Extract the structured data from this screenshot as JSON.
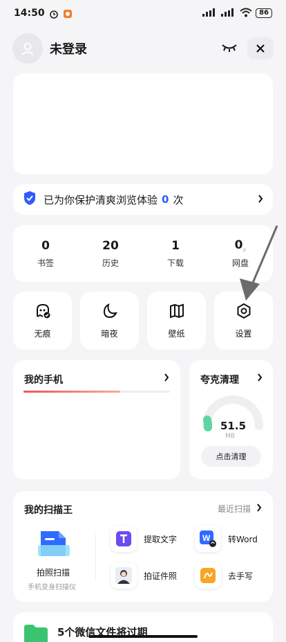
{
  "status": {
    "time": "14:50",
    "battery": "86"
  },
  "header": {
    "title": "未登录"
  },
  "protect": {
    "prefix": "已为你保护清爽浏览体验",
    "count": "0",
    "suffix": "次"
  },
  "stats": [
    {
      "value": "0",
      "label": "书签"
    },
    {
      "value": "20",
      "label": "历史"
    },
    {
      "value": "1",
      "label": "下载"
    },
    {
      "value": "0",
      "unit": "B",
      "label": "网盘"
    }
  ],
  "tools": [
    {
      "label": "无痕",
      "icon": "incognito-icon"
    },
    {
      "label": "暗夜",
      "icon": "moon-icon"
    },
    {
      "label": "壁纸",
      "icon": "wallpaper-icon"
    },
    {
      "label": "设置",
      "icon": "settings-icon"
    }
  ],
  "phone": {
    "title": "我的手机",
    "usage": 0.66
  },
  "clean": {
    "title": "夸克清理",
    "value": "51.5",
    "unit": "MB",
    "button": "点击清理"
  },
  "scan": {
    "title": "我的扫描王",
    "recent": "最近扫描",
    "main_label": "拍照扫描",
    "main_sub": "手机变身扫描仪",
    "items": [
      {
        "label": "提取文字",
        "icon": "extract-text-icon"
      },
      {
        "label": "转Word",
        "icon": "word-icon"
      },
      {
        "label": "拍证件照",
        "icon": "id-photo-icon"
      },
      {
        "label": "去手写",
        "icon": "remove-handwriting-icon"
      }
    ]
  },
  "bottom": {
    "text": "5个微信文件将过期"
  },
  "colors": {
    "accent": "#2e5bff",
    "clean_ring": "#5ed6a4",
    "bar": "#e55555"
  }
}
